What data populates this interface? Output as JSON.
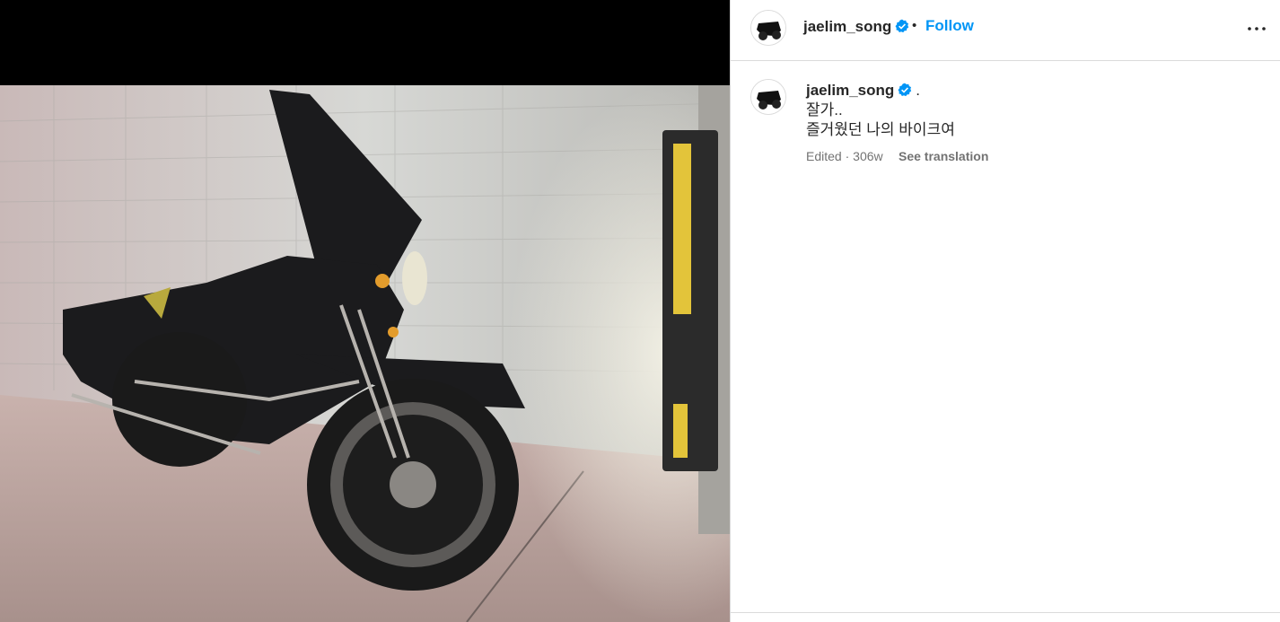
{
  "post": {
    "username": "jaelim_song",
    "separator": "•",
    "follow_label": "Follow",
    "caption_suffix": ".",
    "caption_text": "잘가..\n즐거웠던 나의 바이크여",
    "edited_label": "Edited",
    "meta_separator": " · ",
    "age": "306w",
    "see_translation_label": "See translation"
  },
  "icons": {
    "verified": "verified-badge-icon",
    "more": "more-options-icon"
  },
  "colors": {
    "accent": "#0095f6",
    "verified": "#0095f6",
    "muted": "#737373",
    "border": "#dbdbdb"
  }
}
